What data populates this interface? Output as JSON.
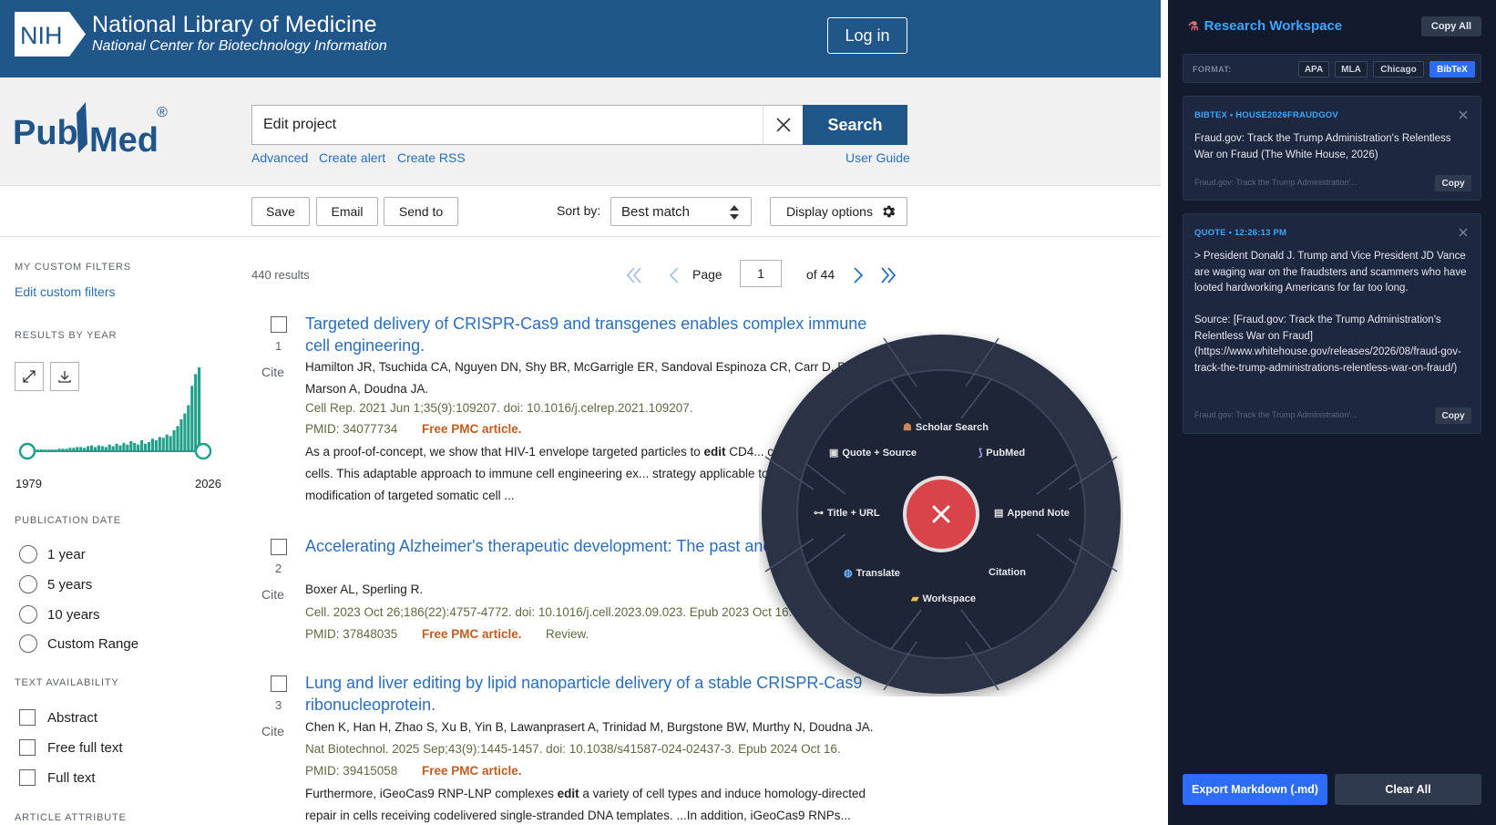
{
  "nih": {
    "logo_text": "NIH",
    "title": "National Library of Medicine",
    "subtitle": "National Center for Biotechnology Information",
    "login_label": "Log in"
  },
  "pubmed_logo": {
    "text_pub": "Pub",
    "text_med": "Med",
    "registered": "®"
  },
  "search": {
    "value": "Edit project",
    "button_label": "Search",
    "links": [
      "Advanced",
      "Create alert",
      "Create RSS"
    ],
    "user_guide": "User Guide"
  },
  "actions": {
    "save": "Save",
    "email": "Email",
    "send_to": "Send to",
    "sort_label": "Sort by:",
    "sort_value": "Best match",
    "display_options": "Display options"
  },
  "sidebar": {
    "custom_filters_heading": "MY CUSTOM FILTERS",
    "edit_custom_filters": "Edit custom filters",
    "results_by_year_heading": "RESULTS BY YEAR",
    "year_start": "1979",
    "year_end": "2026",
    "histogram": [
      0.02,
      0.02,
      0.02,
      0.02,
      0.02,
      0.02,
      0.02,
      0.02,
      0.03,
      0.03,
      0.03,
      0.04,
      0.04,
      0.05,
      0.05,
      0.04,
      0.06,
      0.07,
      0.05,
      0.07,
      0.06,
      0.05,
      0.08,
      0.06,
      0.09,
      0.07,
      0.1,
      0.08,
      0.12,
      0.1,
      0.08,
      0.13,
      0.09,
      0.11,
      0.15,
      0.13,
      0.17,
      0.16,
      0.2,
      0.18,
      0.25,
      0.3,
      0.38,
      0.45,
      0.55,
      0.78,
      0.92,
      1.0
    ],
    "publication_date_heading": "PUBLICATION DATE",
    "date_options": [
      "1 year",
      "5 years",
      "10 years",
      "Custom Range"
    ],
    "text_availability_heading": "TEXT AVAILABILITY",
    "text_options": [
      "Abstract",
      "Free full text",
      "Full text"
    ],
    "article_attribute_heading": "ARTICLE ATTRIBUTE"
  },
  "results": {
    "count": "440 results",
    "page_label": "Page",
    "page_value": "1",
    "of_pages": "of 44",
    "cite_label": "Cite",
    "items": [
      {
        "num": "1",
        "title": "Targeted delivery of CRISPR-Cas9 and transgenes enables complex immune cell engineering.",
        "authors": "Hamilton JR, Tsuchida CA, Nguyen DN, Shy BR, McGarrigle ER, Sandoval Espinoza CR, Carr D, Bl... Marson A, Doudna JA.",
        "journal": "Cell Rep. 2021 Jun 1;35(9):109207. doi: 10.1016/j.celrep.2021.109207.",
        "pmid": "PMID: 34077734",
        "free": "Free PMC article.",
        "snippet_before": "As a proof-of-concept, we show that HIV-1 envelope targeted particles to ",
        "snippet_bold": "edit",
        "snippet_after": " CD4... co-cultured CD8(+) cells. This adaptable approach to immune cell engineering ex... strategy applicable to the genetic modification of targeted somatic cell ..."
      },
      {
        "num": "2",
        "title": "Accelerating Alzheimer's therapeutic development: The past and... trials.",
        "authors": "Boxer AL, Sperling R.",
        "journal": "Cell. 2023 Oct 26;186(22):4757-4772. doi: 10.1016/j.cell.2023.09.023. Epub 2023 Oct 16.",
        "pmid": "PMID: 37848035",
        "free": "Free PMC article.",
        "review": "Review."
      },
      {
        "num": "3",
        "title": "Lung and liver editing by lipid nanoparticle delivery of a stable CRISPR-Cas9 ribonucleoprotein.",
        "authors": "Chen K, Han H, Zhao S, Xu B, Yin B, Lawanprasert A, Trinidad M, Burgstone BW, Murthy N, Doudna JA.",
        "journal": "Nat Biotechnol. 2025 Sep;43(9):1445-1457. doi: 10.1038/s41587-024-02437-3. Epub 2024 Oct 16.",
        "pmid": "PMID: 39415058",
        "free": "Free PMC article.",
        "snippet_before": "Furthermore, iGeoCas9 RNP-LNP complexes ",
        "snippet_bold": "edit",
        "snippet_after": " a variety of cell types and induce homology-directed repair in cells receiving codelivered single-stranded DNA templates. ...In addition, iGeoCas9 RNPs..."
      }
    ]
  },
  "radial": {
    "items": [
      {
        "label": "Scholar Search",
        "icon": "graduation-cap-icon"
      },
      {
        "label": "PubMed",
        "icon": "dna-icon"
      },
      {
        "label": "Append Note",
        "icon": "note-icon"
      },
      {
        "label": "Citation",
        "icon": ""
      },
      {
        "label": "Workspace",
        "icon": "folder-icon"
      },
      {
        "label": "Translate",
        "icon": "globe-icon"
      },
      {
        "label": "Title + URL",
        "icon": "link-icon"
      },
      {
        "label": "Quote + Source",
        "icon": "clipboard-icon"
      }
    ]
  },
  "panel": {
    "title": "Research Workspace",
    "copy_all": "Copy All",
    "format_label": "FORMAT:",
    "formats": [
      "APA",
      "MLA",
      "Chicago",
      "BibTeX"
    ],
    "active_format": "BibTeX",
    "cards": [
      {
        "tag": "BIBTEX • HOUSE2026FRAUDGOV",
        "body": "Fraud.gov: Track the Trump Administration's Relentless War on Fraud (The White House, 2026)",
        "footer": "Fraud.gov: Track the Trump Administration'...",
        "copy": "Copy"
      },
      {
        "tag": "QUOTE • 12:26:13 PM",
        "body": "> President Donald J. Trump and Vice President JD Vance are waging war on the fraudsters and scammers who have looted hardworking Americans for far too long.\n\nSource: [Fraud.gov: Track the Trump Administration's Relentless War on Fraud](https://www.whitehouse.gov/releases/2026/08/fraud-gov-track-the-trump-administrations-relentless-war-on-fraud/)",
        "footer": "Fraud.gov: Track the Trump Administration'...",
        "copy": "Copy"
      }
    ],
    "export_label": "Export Markdown (.md)",
    "clear_label": "Clear All"
  },
  "colors": {
    "nih_blue": "#20558a",
    "link_blue": "#2a6ebb",
    "free_orange": "#c05d1f",
    "panel_bg": "#121a2e",
    "accent_blue": "#2d6cf6",
    "radial_close_red": "#d9444a",
    "histogram_teal": "#20a08a"
  }
}
